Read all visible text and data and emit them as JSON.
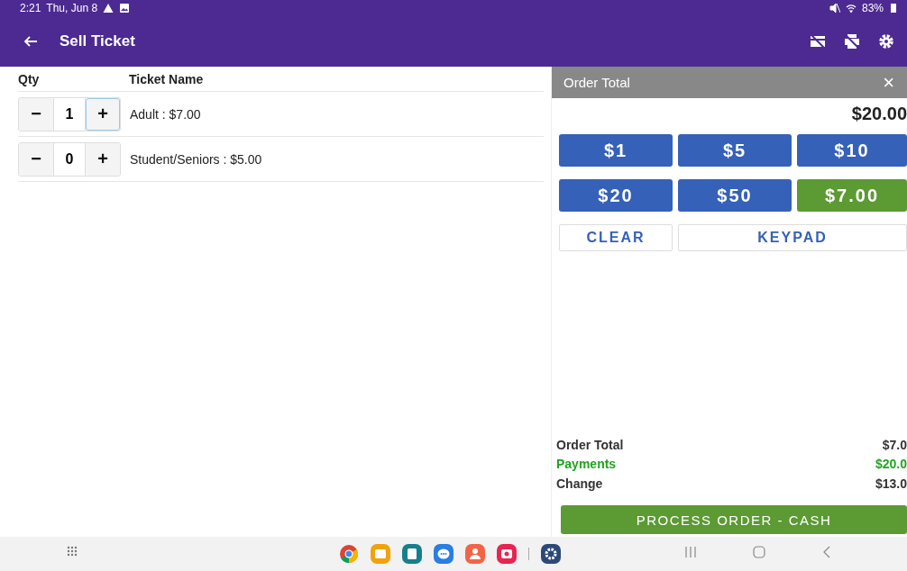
{
  "status_bar": {
    "time": "2:21",
    "date": "Thu, Jun 8",
    "battery": "83%"
  },
  "toolbar": {
    "title": "Sell Ticket"
  },
  "tickets": {
    "columns": [
      "Qty",
      "Ticket Name"
    ],
    "rows": [
      {
        "minus": "−",
        "qty": "1",
        "plus": "+",
        "name": "Adult : $7.00",
        "focused": true
      },
      {
        "minus": "−",
        "qty": "0",
        "plus": "+",
        "name": "Student/Seniors : $5.00",
        "focused": false
      }
    ]
  },
  "order_panel": {
    "title": "Order Total",
    "close": "×",
    "amount": "$20.00",
    "cash_buttons": [
      {
        "label": "$1",
        "kind": "cash"
      },
      {
        "label": "$5",
        "kind": "cash"
      },
      {
        "label": "$10",
        "kind": "cash"
      },
      {
        "label": "$20",
        "kind": "cash"
      },
      {
        "label": "$50",
        "kind": "cash"
      },
      {
        "label": "$7.00",
        "kind": "exact"
      }
    ],
    "actions": [
      "CLEAR",
      "KEYPAD"
    ],
    "totals": [
      {
        "label": "Order Total",
        "value": "$7.0",
        "kind": "plain"
      },
      {
        "label": "Payments",
        "value": "$20.0",
        "kind": "payment"
      },
      {
        "label": "Change",
        "value": "$13.0",
        "kind": "plain"
      }
    ],
    "process_button": "PROCESS ORDER - CASH"
  }
}
